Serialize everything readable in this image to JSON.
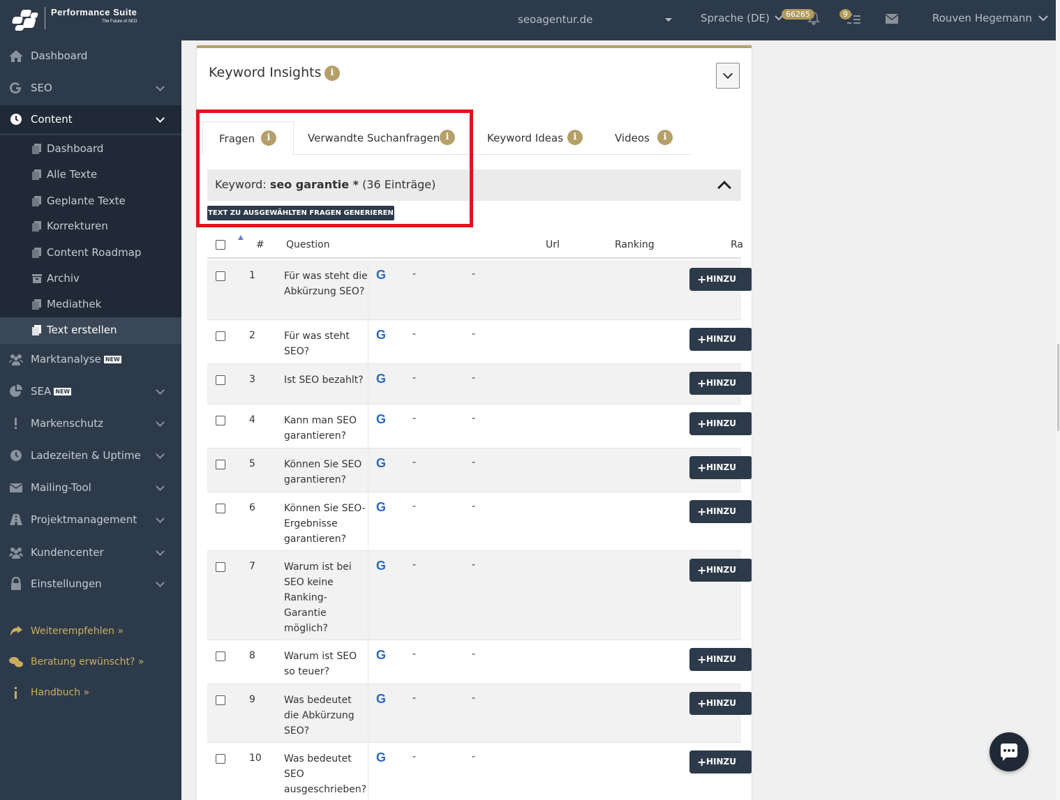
{
  "app": {
    "brand_name": "Performance Suite",
    "brand_tagline": "The Future of SEO"
  },
  "topbar": {
    "domain": "seoagentur.de",
    "language": "Sprache (DE)",
    "points_badge": "66265",
    "notifications_badge": "9",
    "user": "Rouven Hegemann"
  },
  "sidebar": {
    "items": [
      {
        "label": "Dashboard",
        "icon": "home-icon"
      },
      {
        "label": "SEO",
        "icon": "google-icon"
      },
      {
        "label": "Content",
        "icon": "clock-icon"
      },
      {
        "label": "Marktanalyse",
        "icon": "users-icon",
        "badge": "NEW"
      },
      {
        "label": "SEA",
        "icon": "pie-chart-icon",
        "badge": "NEW"
      },
      {
        "label": "Markenschutz",
        "icon": "exclamation-icon"
      },
      {
        "label": "Ladezeiten & Uptime",
        "icon": "clock-icon"
      },
      {
        "label": "Mailing-Tool",
        "icon": "mail-icon"
      },
      {
        "label": "Projektmanagement",
        "icon": "road-icon"
      },
      {
        "label": "Kundencenter",
        "icon": "users-icon"
      },
      {
        "label": "Einstellungen",
        "icon": "lock-icon"
      }
    ],
    "content_sub": [
      {
        "label": "Dashboard"
      },
      {
        "label": "Alle Texte"
      },
      {
        "label": "Geplante Texte"
      },
      {
        "label": "Korrekturen"
      },
      {
        "label": "Content Roadmap"
      },
      {
        "label": "Archiv"
      },
      {
        "label": "Mediathek"
      },
      {
        "label": "Text erstellen"
      }
    ],
    "footer": [
      {
        "label": "Weiterempfehlen »"
      },
      {
        "label": "Beratung erwünscht? »"
      },
      {
        "label": "Handbuch »"
      }
    ]
  },
  "card": {
    "title": "Keyword Insights",
    "info_glyph": "i",
    "tabs": [
      {
        "label": "Fragen"
      },
      {
        "label": "Verwandte Suchanfragen"
      },
      {
        "label": "Keyword Ideas"
      },
      {
        "label": "Videos"
      }
    ],
    "keyword_prefix": "Keyword:",
    "keyword_value": "seo garantie *",
    "keyword_count": "(36 Einträge)",
    "generate_button": "TEXT ZU AUSGEWÄHLTEN FRAGEN GENERIEREN",
    "columns": {
      "num": "#",
      "question": "Question",
      "url": "Url",
      "ranking": "Ranking",
      "ra": "Ra"
    },
    "add_label": "HINZU",
    "rows": [
      {
        "num": "1",
        "question": "Für was steht die Abkürzung SEO?",
        "g": "G",
        "d1": "-",
        "d2": "-"
      },
      {
        "num": "2",
        "question": "Für was steht SEO?",
        "g": "G",
        "d1": "-",
        "d2": "-"
      },
      {
        "num": "3",
        "question": "Ist SEO bezahlt?",
        "g": "G",
        "d1": "-",
        "d2": "-"
      },
      {
        "num": "4",
        "question": "Kann man SEO garantieren?",
        "g": "G",
        "d1": "-",
        "d2": "-"
      },
      {
        "num": "5",
        "question": "Können Sie SEO garantieren?",
        "g": "G",
        "d1": "-",
        "d2": "-"
      },
      {
        "num": "6",
        "question": "Können Sie SEO-Ergebnisse garantieren?",
        "g": "G",
        "d1": "-",
        "d2": "-"
      },
      {
        "num": "7",
        "question": "Warum ist bei SEO keine Ranking-Garantie möglich?",
        "g": "G",
        "d1": "-",
        "d2": "-"
      },
      {
        "num": "8",
        "question": "Warum ist SEO so teuer?",
        "g": "G",
        "d1": "-",
        "d2": "-"
      },
      {
        "num": "9",
        "question": "Was bedeutet die Abkürzung SEO?",
        "g": "G",
        "d1": "-",
        "d2": "-"
      },
      {
        "num": "10",
        "question": "Was bedeutet SEO ausgeschrieben?",
        "g": "G",
        "d1": "-",
        "d2": "-"
      }
    ]
  },
  "colors": {
    "sidebar_bg": "#2d3a4a",
    "accent_gold": "#b5a06a",
    "highlight_red": "#e3131c",
    "google_blue": "#2a6ab8"
  }
}
